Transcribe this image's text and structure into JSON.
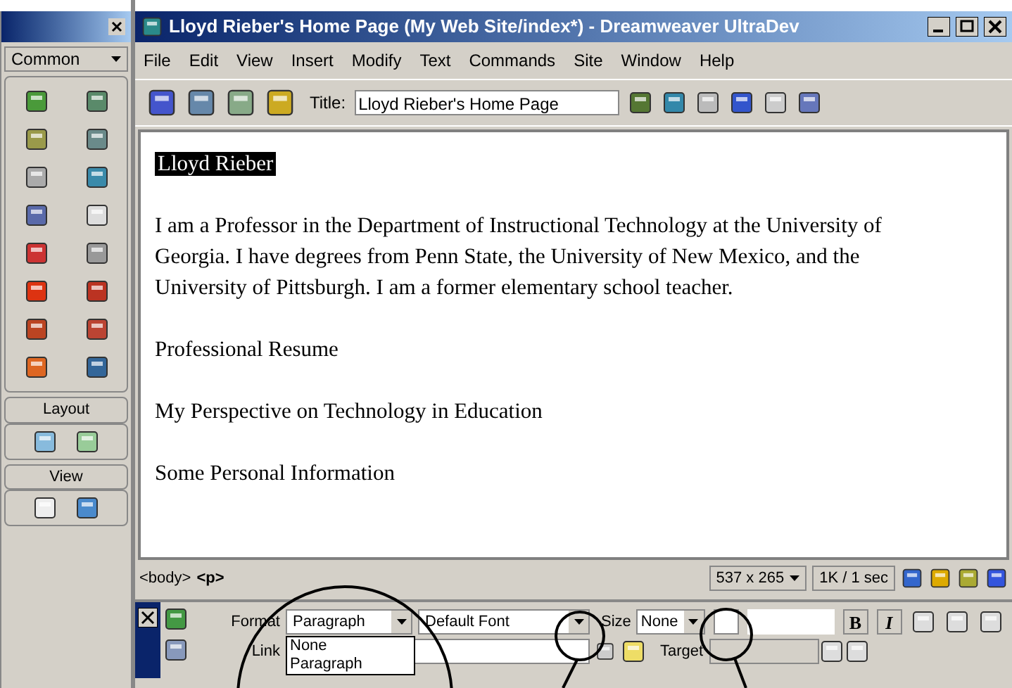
{
  "palette": {
    "category": "Common",
    "sections": [
      "Layout",
      "View"
    ]
  },
  "window": {
    "title": "Lloyd Rieber's Home Page (My Web Site/index*) - Dreamweaver UltraDev"
  },
  "menu": [
    "File",
    "Edit",
    "View",
    "Insert",
    "Modify",
    "Text",
    "Commands",
    "Site",
    "Window",
    "Help"
  ],
  "toolbar": {
    "title_label": "Title:",
    "title_value": "Lloyd Rieber's Home Page"
  },
  "document": {
    "heading": {
      "text": "Lloyd Rieber",
      "selected": true
    },
    "paragraphs": [
      "I am a Professor in the Department of Instructional Technology at the University of Georgia. I have degrees from Penn State, the University of New Mexico, and the University of Pittsburgh. I am a former elementary school teacher.",
      "Professional Resume",
      "My Perspective on Technology in Education",
      "Some Personal Information"
    ]
  },
  "status_bar": {
    "tags": [
      "<body>",
      "<p>"
    ],
    "window_size": "537 x 265",
    "download": "1K / 1 sec"
  },
  "properties": {
    "format_label": "Format",
    "format_value": "Paragraph",
    "format_options": [
      {
        "label": "None",
        "selected": false
      },
      {
        "label": "Paragraph",
        "selected": false
      }
    ],
    "font_value": "Default Font",
    "size_label": "Size",
    "size_value": "None",
    "link_label": "Link",
    "target_label": "Target",
    "bold": "B",
    "italic": "I"
  }
}
